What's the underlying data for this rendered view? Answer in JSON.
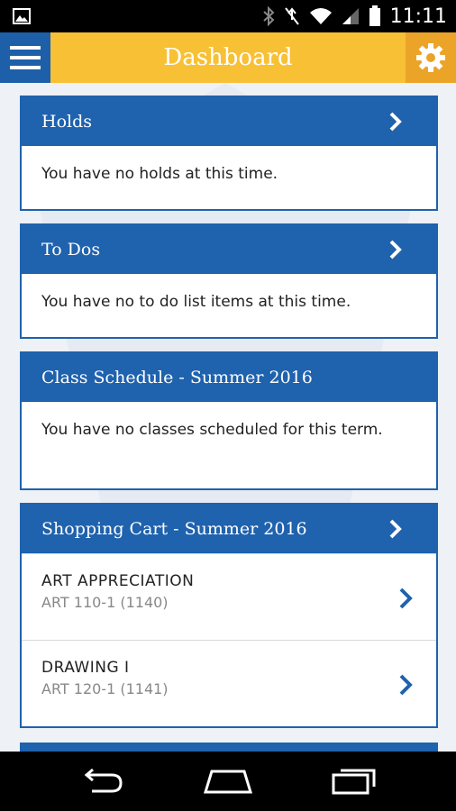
{
  "status_bar": {
    "time": "11:11"
  },
  "app_bar": {
    "title": "Dashboard",
    "colors": {
      "bar": "#f7c035",
      "menu_bg": "#1e5faa",
      "settings_bg": "#eba427"
    }
  },
  "cards": {
    "holds": {
      "title": "Holds",
      "message": "You have no holds at this time."
    },
    "todos": {
      "title": "To Dos",
      "message": "You have no to do list items at this time."
    },
    "class_schedule": {
      "title": "Class Schedule - Summer 2016",
      "message": "You have no classes scheduled for this term."
    },
    "shopping_cart": {
      "title": "Shopping Cart - Summer 2016",
      "items": [
        {
          "name": "ART APPRECIATION",
          "code": "ART 110-1 (1140)"
        },
        {
          "name": "DRAWING I",
          "code": "ART 120-1 (1141)"
        }
      ]
    }
  },
  "accent_color": "#1f62ad"
}
